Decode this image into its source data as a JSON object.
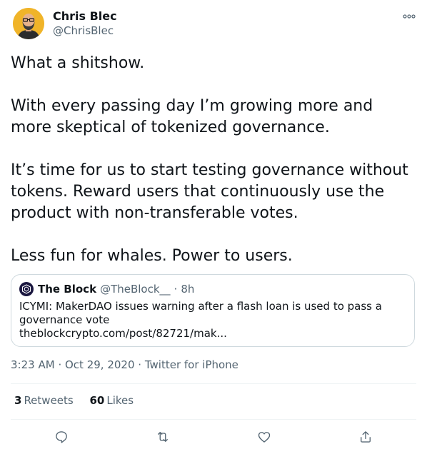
{
  "author": {
    "name": "Chris Blec",
    "handle": "@ChrisBlec"
  },
  "tweet": {
    "paragraphs": [
      "What a shitshow.",
      "With every passing day I’m growing more and more skeptical of tokenized governance.",
      "It’s time for us to start testing governance without tokens. Reward users that continuously use the product with non-transferable votes.",
      "Less fun for whales. Power to users."
    ]
  },
  "quote": {
    "name": "The Block",
    "handle": "@TheBlock__",
    "separator": "·",
    "time": "8h",
    "text": "ICYMI: MakerDAO issues warning after a flash loan is used to pass a governance vote",
    "link": "theblockcrypto.com/post/82721/mak..."
  },
  "meta": {
    "time": "3:23 AM",
    "sep": "·",
    "date": "Oct 29, 2020",
    "source": "Twitter for iPhone"
  },
  "stats": {
    "retweets_count": "3",
    "retweets_label": "Retweets",
    "likes_count": "60",
    "likes_label": "Likes"
  },
  "actions": {
    "reply_icon": "reply-icon",
    "retweet_icon": "retweet-icon",
    "like_icon": "heart-icon",
    "share_icon": "share-icon"
  },
  "colors": {
    "text": "#0f1419",
    "secondary": "#536471",
    "border": "#cfd9de",
    "divider": "#eff3f4",
    "quote_logo": "#1b1740",
    "avatar_bg": "#f0b429"
  }
}
